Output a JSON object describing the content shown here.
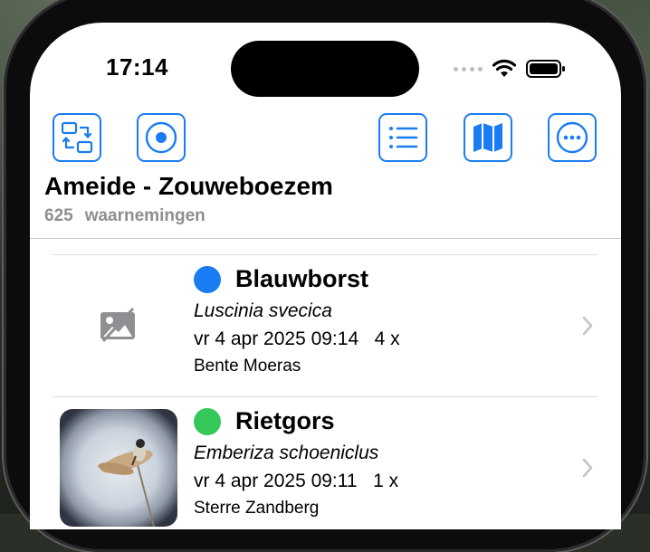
{
  "status_bar": {
    "time": "17:14"
  },
  "toolbar": {
    "buttons": [
      {
        "icon": "switch-arrows-icon"
      },
      {
        "icon": "target-icon"
      },
      {
        "icon": "list-icon"
      },
      {
        "icon": "map-icon"
      },
      {
        "icon": "more-icon"
      }
    ],
    "accent_color": "#1a7cf2"
  },
  "header": {
    "title": "Ameide - Zouweboezem",
    "count": "625",
    "count_label": "waarnemingen"
  },
  "observations": [
    {
      "name": "Blauwborst",
      "latin": "Luscinia svecica",
      "date": "vr 4 apr 2025 09:14",
      "quantity": "4 x",
      "observer": "Bente Moeras",
      "status_color": "#1a7cf2",
      "has_photo": false
    },
    {
      "name": "Rietgors",
      "latin": "Emberiza schoeniclus",
      "date": "vr 4 apr 2025 09:11",
      "quantity": "1 x",
      "observer": "Sterre Zandberg",
      "status_color": "#34c759",
      "has_photo": true
    }
  ]
}
